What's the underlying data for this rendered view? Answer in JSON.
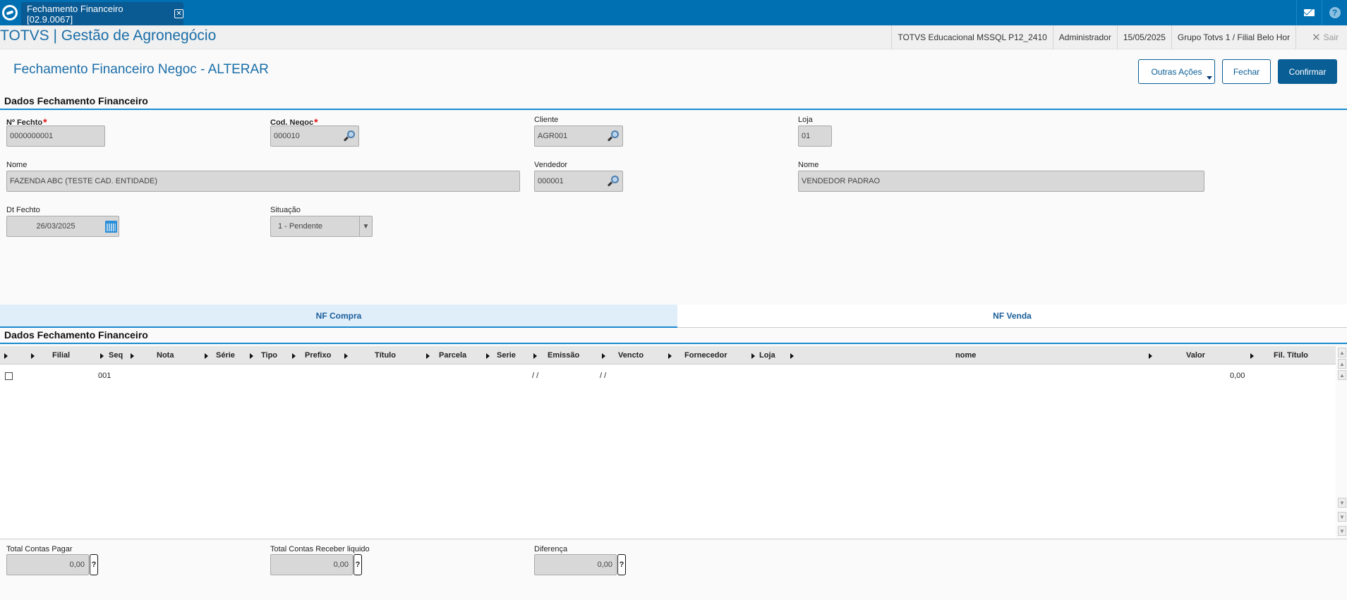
{
  "window_tab": {
    "label": "Fechamento Financeiro [02.9.0067]"
  },
  "app": {
    "title": "TOTVS | Gestão de Agronegócio"
  },
  "header_info": {
    "environment": "TOTVS Educacional MSSQL P12_2410",
    "user": "Administrador",
    "date": "15/05/2025",
    "branch": "Grupo Totvs 1 / Filial Belo Hor",
    "exit_label": "Sair"
  },
  "page": {
    "title": "Fechamento Financeiro Negoc - ALTERAR"
  },
  "actions": {
    "other_label": "Outras Ações",
    "close_label": "Fechar",
    "confirm_label": "Confirmar"
  },
  "section1": {
    "title": "Dados Fechamento Financeiro"
  },
  "form": {
    "n_fecho": {
      "label": "Nº Fechto",
      "value": "0000000001"
    },
    "cod_negoc": {
      "label": "Cod. Negoc",
      "value": "000010"
    },
    "cliente": {
      "label": "Cliente",
      "value": "AGR001"
    },
    "loja": {
      "label": "Loja",
      "value": "01"
    },
    "nome_cliente": {
      "label": "Nome",
      "value": "FAZENDA ABC (TESTE CAD. ENTIDADE)"
    },
    "vendedor": {
      "label": "Vendedor",
      "value": "000001"
    },
    "nome_vendedor": {
      "label": "Nome",
      "value": "VENDEDOR PADRAO"
    },
    "dt_fechto": {
      "label": "Dt Fechto",
      "value": "26/03/2025"
    },
    "situacao": {
      "label": "Situação",
      "value": "1 - Pendente"
    }
  },
  "tabs": [
    {
      "label": "NF Compra"
    },
    {
      "label": "NF Venda"
    }
  ],
  "section2": {
    "title": "Dados Fechamento Financeiro"
  },
  "grid": {
    "columns": [
      "Filial",
      "Seq",
      "Nota",
      "Série",
      "Tipo",
      "Prefixo",
      "Título",
      "Parcela",
      "Serie",
      "Emissão",
      "Vencto",
      "Fornecedor",
      "Loja",
      "nome",
      "Valor",
      "Fil. Título"
    ],
    "rows": [
      {
        "seq": "001",
        "emissao": "/ /",
        "vencto": "/ /",
        "valor": "0,00"
      }
    ]
  },
  "totals": {
    "pagar": {
      "label": "Total Contas Pagar",
      "value": "0,00"
    },
    "receber": {
      "label": "Total Contas Receber liquido",
      "value": "0,00"
    },
    "diferenca": {
      "label": "Diferença",
      "value": "0,00"
    },
    "help_symbol": "?"
  },
  "icons": [
    "totvs-logo-icon",
    "mail-icon",
    "help-icon",
    "close-icon",
    "search-icon",
    "calendar-icon",
    "chevron-down-icon"
  ],
  "colors": {
    "brand": "#0070b3",
    "accent": "#0a5e96",
    "required": "#e01010"
  }
}
